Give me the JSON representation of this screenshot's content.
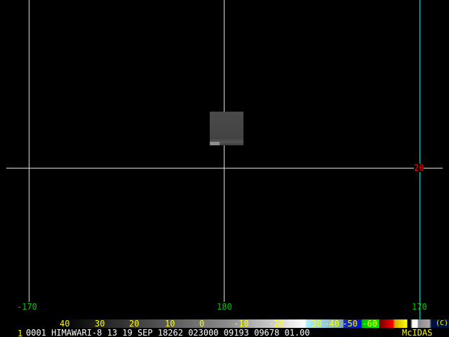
{
  "map": {
    "lon_labels": [
      "-170",
      "180",
      "170"
    ],
    "lat_label": "20",
    "grid_color": "#c8e6e6",
    "edge_line_color": "#00e0e0"
  },
  "colorbar": {
    "labels": [
      "40",
      "30",
      "20",
      "10",
      "0",
      "-10",
      "-20",
      "-30",
      "-40",
      "-50",
      "-60"
    ],
    "copyright": "(C)"
  },
  "status": {
    "frame": "1",
    "info": "0001 HIMAWARI-8 13 19 SEP 18262 023000 09193 09678 01.00",
    "brand": "McIDAS"
  }
}
